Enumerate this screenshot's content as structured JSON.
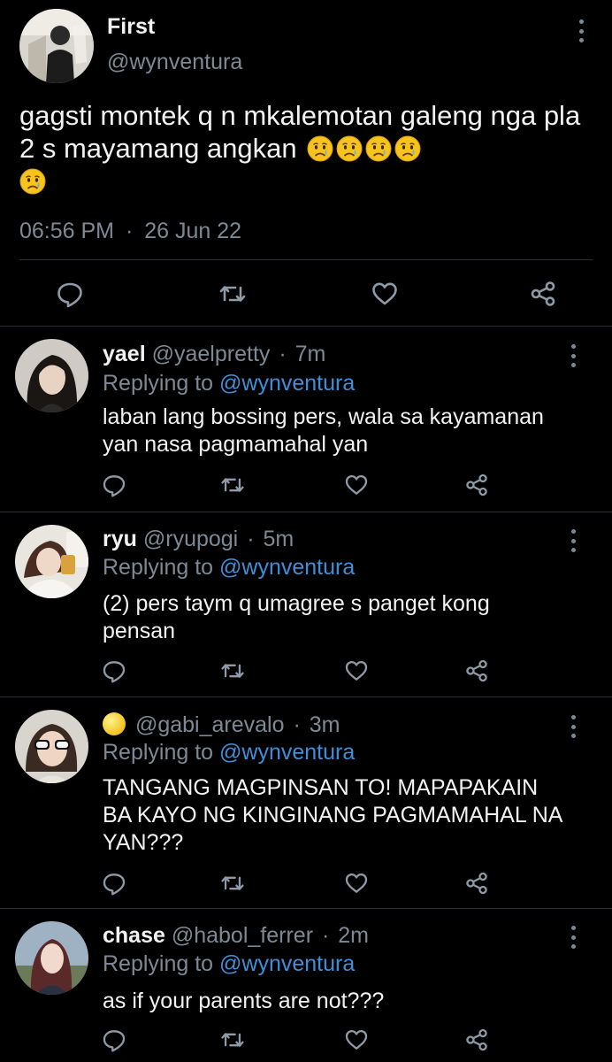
{
  "main_tweet": {
    "display_name": "First",
    "handle": "@wynventura",
    "text": "gagsti montek q n mkalemotan galeng nga pla 2 s mayamang angkan",
    "emojis": [
      "crying-face",
      "crying-face",
      "crying-face",
      "crying-face",
      "crying-face"
    ],
    "time": "06:56 PM",
    "separator": "·",
    "date": "26 Jun 22"
  },
  "replies": [
    {
      "name": "yael",
      "handle": "@yaelpretty",
      "separator": "·",
      "age": "7m",
      "replying_prefix": "Replying to ",
      "replying_to": "@wynventura",
      "text_line1": "laban lang bossing pers, wala sa kayamanan",
      "text_line2": "yan nasa pagmamahal yan",
      "text_line3": ""
    },
    {
      "name": "ryu",
      "handle": "@ryupogi",
      "separator": "·",
      "age": "5m",
      "replying_prefix": "Replying to ",
      "replying_to": "@wynventura",
      "text_line1": "(2) pers taym q umagree s panget kong",
      "text_line2": "pensan",
      "text_line3": ""
    },
    {
      "name": "",
      "name_emoji": "moon-emoji",
      "handle": "@gabi_arevalo",
      "separator": "·",
      "age": "3m",
      "replying_prefix": "Replying to ",
      "replying_to": "@wynventura",
      "text_line1": "TANGANG MAGPINSAN TO! MAPAPAKAIN",
      "text_line2": "BA KAYO NG KINGINANG PAGMAMAHAL NA",
      "text_line3": "YAN???"
    },
    {
      "name": "chase",
      "handle": "@habol_ferrer",
      "separator": "·",
      "age": "2m",
      "replying_prefix": "Replying to ",
      "replying_to": "@wynventura",
      "text_line1": "as if your parents are not???",
      "text_line2": "",
      "text_line3": ""
    }
  ],
  "actions": [
    "reply-icon",
    "retweet-icon",
    "like-icon",
    "share-icon"
  ],
  "colors": {
    "background": "#000000",
    "text": "#f2f2f2",
    "muted": "#7d8a96",
    "link": "#3f8fd8",
    "divider": "#2a2f34"
  }
}
